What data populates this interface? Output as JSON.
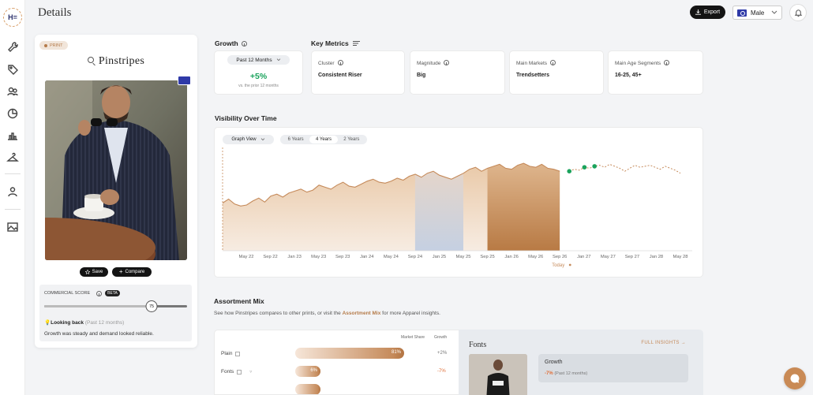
{
  "header": {
    "title": "Details",
    "export_label": "Export",
    "gender_value": "Male"
  },
  "print": {
    "badge": "PRINT",
    "name": "Pinstripes",
    "save_label": "Save",
    "compare_label": "Compare",
    "commercial_score_label": "COMMERCIAL SCORE",
    "beta_label": "BETA",
    "commercial_score": 75,
    "commercial_score_max": 100,
    "looking_title": "Looking back",
    "looking_period": "(Past 12 months)",
    "looking_text": "Growth was steady and demand looked reliable."
  },
  "growth": {
    "title": "Growth",
    "period": "Past 12 Months",
    "value": "+5%",
    "sub": "vs. the prior 12 months"
  },
  "key_metrics": {
    "title": "Key Metrics",
    "cards": [
      {
        "label": "Cluster",
        "value": "Consistent Riser"
      },
      {
        "label": "Magnitude",
        "value": "Big"
      },
      {
        "label": "Main Markets",
        "value": "Trendsetters"
      },
      {
        "label": "Main Age Segments",
        "value": "16-25, 45+"
      }
    ]
  },
  "visibility": {
    "title": "Visibility Over Time",
    "view_label": "Graph View",
    "ranges": [
      "6 Years",
      "4 Years",
      "2 Years"
    ],
    "active_range": "4 Years",
    "today_label": "Today"
  },
  "chart_data": {
    "type": "area",
    "x_ticks": [
      "May 22",
      "Sep 22",
      "Jan 23",
      "May 23",
      "Sep 23",
      "Jan 24",
      "May 24",
      "Sep 24",
      "Jan 25",
      "May 25",
      "Sep 25",
      "Jan 26",
      "May 26",
      "Sep 26",
      "Jan 27",
      "May 27",
      "Sep 27",
      "Jan 28",
      "May 28"
    ],
    "today": "Sep 26",
    "series": [
      {
        "values": [
          0.48,
          0.52,
          0.47,
          0.45,
          0.46,
          0.5,
          0.53,
          0.49,
          0.55,
          0.57,
          0.54,
          0.58,
          0.6,
          0.62,
          0.59,
          0.61,
          0.66,
          0.64,
          0.62,
          0.66,
          0.69,
          0.65,
          0.64,
          0.67,
          0.7,
          0.72,
          0.69,
          0.68,
          0.7,
          0.73,
          0.71,
          0.75,
          0.77,
          0.74,
          0.78,
          0.8,
          0.76,
          0.74,
          0.72,
          0.75,
          0.78,
          0.82,
          0.84,
          0.8,
          0.83,
          0.85,
          0.87,
          0.83,
          0.82,
          0.86,
          0.88,
          0.85,
          0.84,
          0.87,
          0.83,
          0.82,
          0.8
        ]
      },
      {
        "values": [
          0.8,
          0.82,
          0.81,
          0.84,
          0.83,
          0.85,
          0.86,
          0.84,
          0.87,
          0.85,
          0.83,
          0.8,
          0.83,
          0.86,
          0.84,
          0.85,
          0.86,
          0.84,
          0.82,
          0.85,
          0.83,
          0.81,
          0.78
        ]
      }
    ],
    "highlighted_ranges": [
      [
        "Sep 24",
        "May 25"
      ],
      [
        "Sep 25",
        "Sep 26"
      ]
    ]
  },
  "assortment": {
    "title": "Assortment Mix",
    "desc_prefix": "See how Pinstripes compares to other prints, or visit the",
    "desc_link": "Assortment Mix",
    "desc_suffix": "for more Apparel insights.",
    "col_market_share": "Market Share",
    "col_growth": "Growth",
    "rows": [
      {
        "label": "Plain",
        "share": 81,
        "share_text": "81%",
        "growth": "+2%",
        "growth_color": "#777777"
      },
      {
        "label": "Fonts",
        "share": 6,
        "share_text": "6%",
        "growth": "-7%",
        "growth_color": "#e0703a"
      },
      {
        "label": "",
        "share": 6,
        "share_text": "",
        "growth": "",
        "growth_color": "#777777"
      }
    ]
  },
  "fonts_panel": {
    "title": "Fonts",
    "full_insights": "FULL INSIGHTS →",
    "growth_label": "Growth",
    "growth_value": "-7%",
    "growth_period": "(Past 12 months)"
  },
  "colors": {
    "accent": "#c58a5a",
    "positive": "#1aa35c",
    "negative": "#e0703a"
  }
}
